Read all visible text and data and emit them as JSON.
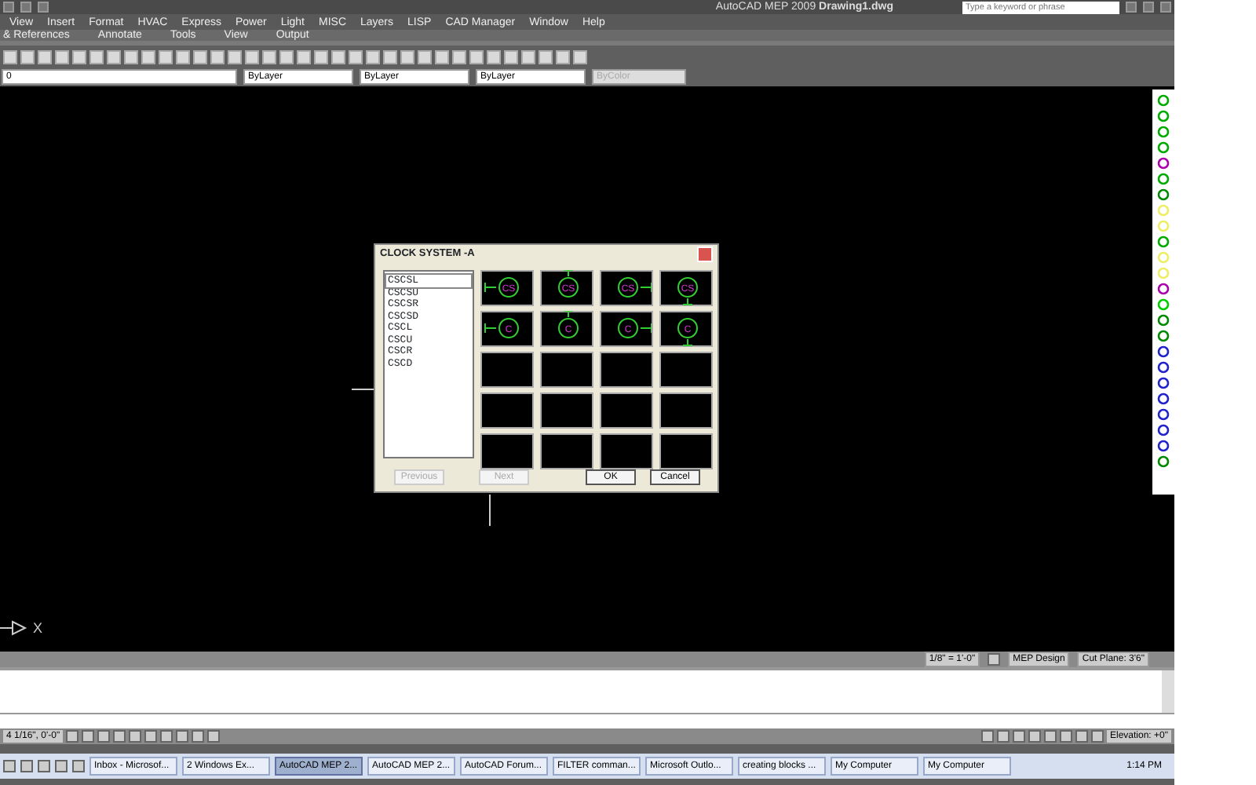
{
  "window": {
    "title": "AutoCAD MEP 2009 **Drawing1.dwg**",
    "search_placeholder": "Type a keyword or phrase"
  },
  "menu": [
    "View",
    "Insert",
    "Format",
    "HVAC",
    "Express",
    "Power",
    "Light",
    "MISC",
    "Layers",
    "LISP",
    "CAD Manager",
    "Window",
    "Help"
  ],
  "ribbon_tabs": [
    "& References",
    "Annotate",
    "Tools",
    "View",
    "Output"
  ],
  "layer_bar": [
    {
      "value": "0",
      "disabled": false
    },
    {
      "value": "ByLayer",
      "disabled": false
    },
    {
      "value": "ByLayer",
      "disabled": false
    },
    {
      "value": "ByLayer",
      "disabled": false
    },
    {
      "value": "ByColor",
      "disabled": true
    }
  ],
  "dialog": {
    "title": "CLOCK SYSTEM -A",
    "list": [
      {
        "label": "CSCSL",
        "selected": true
      },
      {
        "label": "CSCSU",
        "selected": false
      },
      {
        "label": "CSCSR",
        "selected": false
      },
      {
        "label": "CSCSD",
        "selected": false
      },
      {
        "label": "CSCL",
        "selected": false
      },
      {
        "label": "CSCU",
        "selected": false
      },
      {
        "label": "CSCR",
        "selected": false
      },
      {
        "label": "CSCD",
        "selected": false
      }
    ],
    "symbols": [
      {
        "label": "CS",
        "kind": "left"
      },
      {
        "label": "CS",
        "kind": "up"
      },
      {
        "label": "CS",
        "kind": "right"
      },
      {
        "label": "CS",
        "kind": "down"
      },
      {
        "label": "C",
        "kind": "left"
      },
      {
        "label": "C",
        "kind": "up"
      },
      {
        "label": "C",
        "kind": "right"
      },
      {
        "label": "C",
        "kind": "down"
      }
    ],
    "buttons": [
      {
        "label": "Previous",
        "disabled": true
      },
      {
        "label": "Next",
        "disabled": true
      },
      {
        "label": "OK",
        "disabled": false
      },
      {
        "label": "Cancel",
        "disabled": false
      }
    ]
  },
  "canvas": {
    "axis_label": "X"
  },
  "status_row": {
    "scale": "1/8\" = 1'-0\"",
    "display": "MEP Design",
    "cut_plane": "Cut Plane: 3'6\""
  },
  "status_bar": {
    "coordinates": "4 1/16\", 0'-0\"",
    "elevation": "Elevation: +0\""
  },
  "taskbar": {
    "items": [
      {
        "label": "Inbox - Microsof...",
        "active": false
      },
      {
        "label": "2 Windows Ex...",
        "active": false
      },
      {
        "label": "AutoCAD MEP 2...",
        "active": true
      },
      {
        "label": "AutoCAD MEP 2...",
        "active": false
      },
      {
        "label": "AutoCAD Forum...",
        "active": false
      },
      {
        "label": "FILTER comman...",
        "active": false
      },
      {
        "label": "Microsoft Outlo...",
        "active": false
      },
      {
        "label": "creating blocks ...",
        "active": false
      },
      {
        "label": "My Computer",
        "active": false
      },
      {
        "label": "My Computer",
        "active": false
      }
    ],
    "clock": "1:14 PM"
  }
}
